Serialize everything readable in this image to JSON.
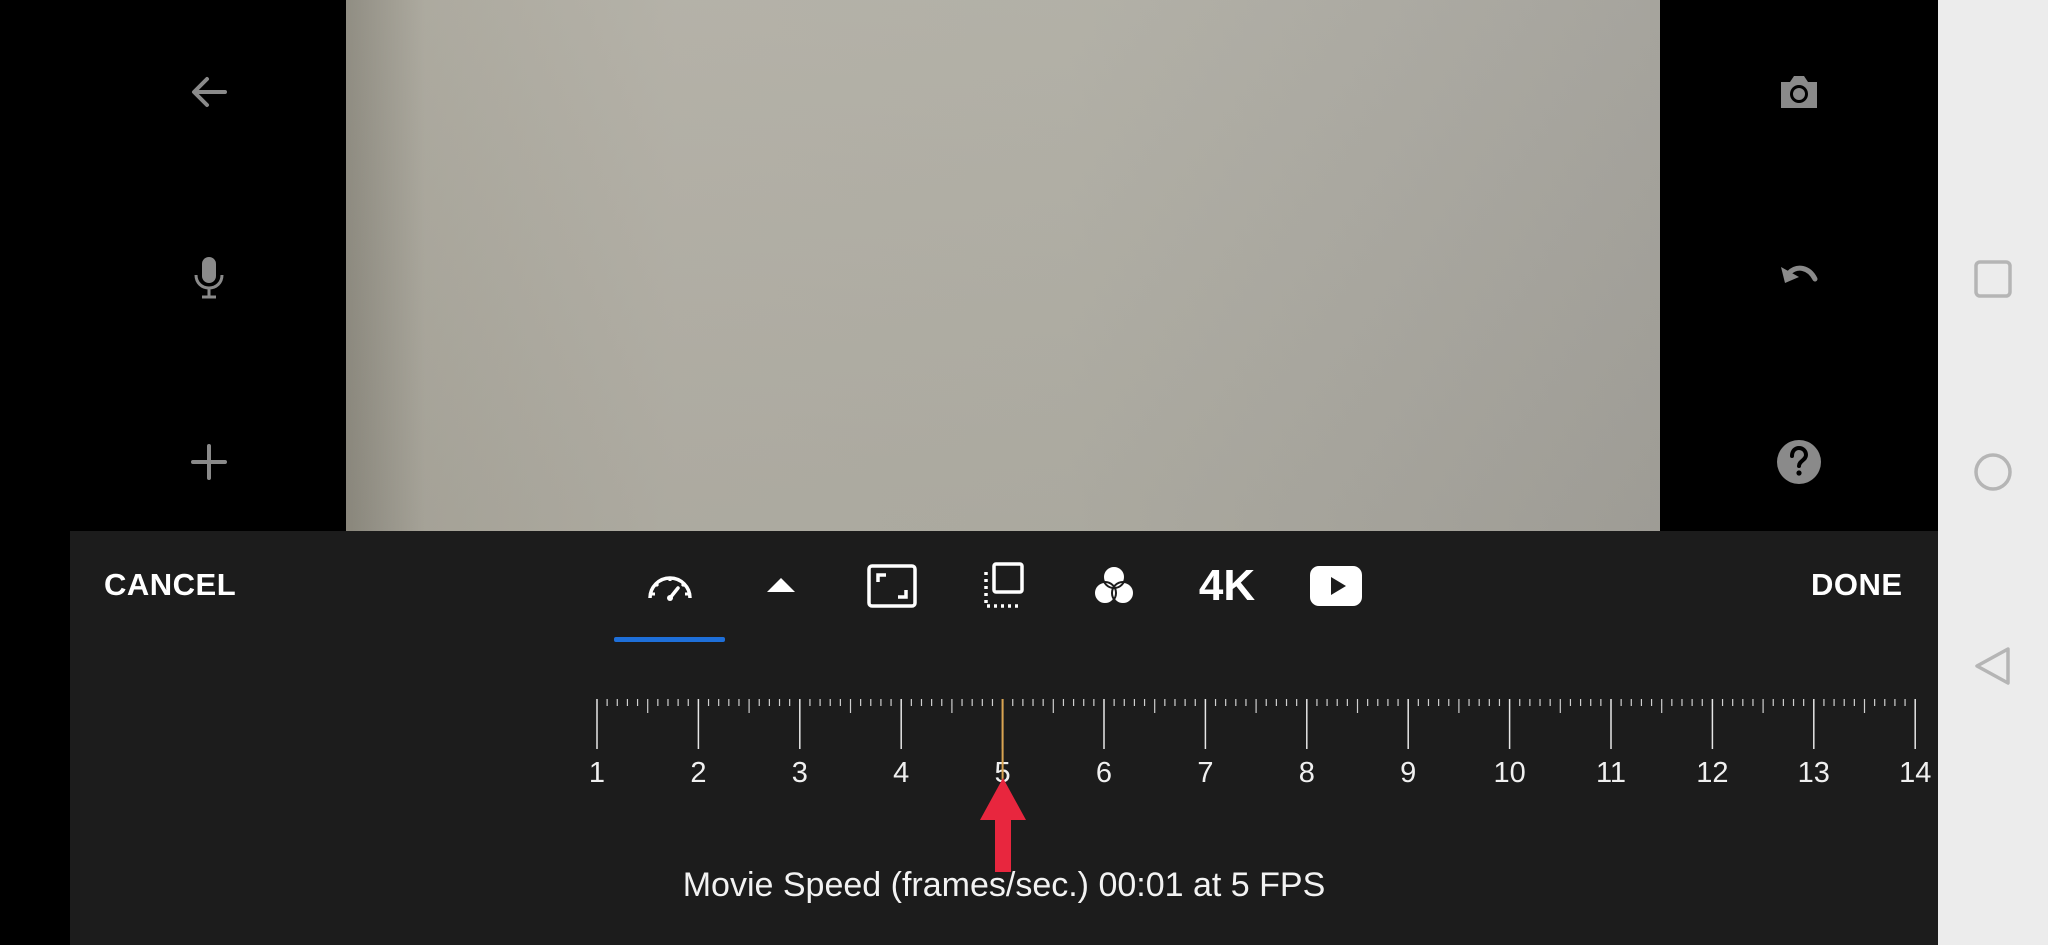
{
  "editor": {
    "cancel_label": "CANCEL",
    "done_label": "DONE",
    "resolution_label": "4K",
    "status_text": "Movie Speed (frames/sec.) 00:01 at 5 FPS"
  },
  "speed_ruler": {
    "ticks": [
      "1",
      "2",
      "3",
      "4",
      "5",
      "6",
      "7",
      "8",
      "9",
      "10",
      "11",
      "12",
      "13",
      "14"
    ],
    "selected_value": 5,
    "indicator_color": "#d9a451",
    "arrow_color": "#e8263e"
  },
  "left_rail_icons": [
    "back-arrow-icon",
    "microphone-icon",
    "plus-icon"
  ],
  "right_rail_icons": [
    "camera-icon",
    "undo-icon",
    "help-icon"
  ],
  "toolbar_icons": [
    "speedometer-icon",
    "triangle-up-icon",
    "aspect-ratio-icon",
    "frames-icon",
    "color-filter-icon",
    "4k-label",
    "youtube-play-icon"
  ],
  "colors": {
    "panel_bg": "#1c1c1c",
    "accent_underline": "#1e6fd9",
    "nav_bar_bg": "#ececec"
  }
}
